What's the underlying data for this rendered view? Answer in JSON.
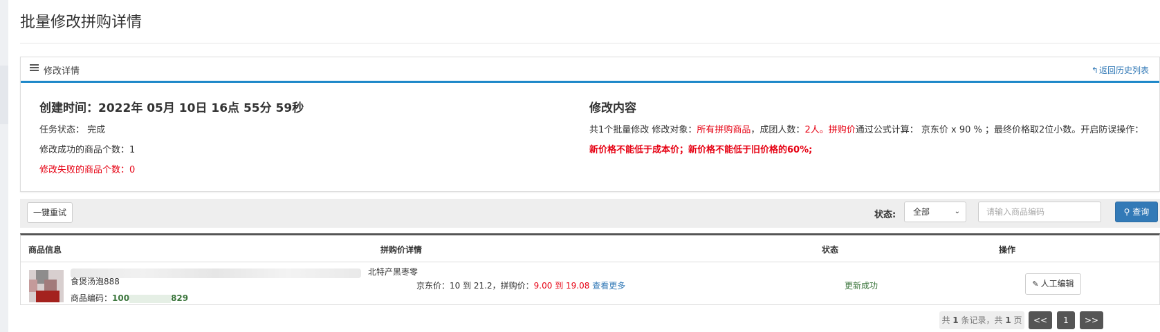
{
  "page": {
    "title": "批量修改拼购详情"
  },
  "panel": {
    "header_title": "修改详情",
    "back_label": "返回历史列表",
    "create_time": "创建时间：2022年 05月 10日 16点 55分 59秒",
    "task_status_label": "任务状态：",
    "task_status_value": "完成",
    "success_label": "修改成功的商品个数：",
    "success_count": "1",
    "fail_label": "修改失败的商品个数：",
    "fail_count": "0",
    "content_heading": "修改内容",
    "desc": {
      "p1": "共1个批量修改 修改对象：",
      "target": "所有拼购商品",
      "p2": "，成团人数：",
      "group_size": "2人",
      "p3": "。",
      "price_word": "拼购价",
      "p4": "通过公式计算：  京东价 x 90 % ；最终价格取2位小数。开启防误操作：",
      "guard": "新价格不能低于成本价；新价格不能低于旧价格的60%;"
    }
  },
  "toolbar": {
    "retry_label": "一键重试",
    "status_label": "状态:",
    "status_value": "全部",
    "search_placeholder": "请输入商品编码",
    "query_label": "查询"
  },
  "table": {
    "headers": [
      "商品信息",
      "拼购价详情",
      "状态",
      "操作"
    ],
    "rows": [
      {
        "name_visible": "北特产黑枣零食煲汤泡888",
        "code_label": "商品编码：",
        "code_prefix": "100",
        "code_suffix": "829",
        "price_jd_label": "京东价：",
        "price_jd_range": "10 到 21.2",
        "price_pg_label": "，拼购价：",
        "price_pg_range": "9.00 到 19.08",
        "more_label": "查看更多",
        "status": "更新成功",
        "action_label": "人工编辑"
      }
    ]
  },
  "pagination": {
    "info_prefix": "共",
    "total_records": "1",
    "info_mid": "条记录，共",
    "total_pages": "1",
    "info_suffix": "页",
    "prev": "<<",
    "current": "1",
    "next": ">>"
  },
  "colors": {
    "accent": "#337ab7",
    "danger": "#e60012",
    "success": "#3c763d",
    "panel_rule": "#1e88c9"
  }
}
